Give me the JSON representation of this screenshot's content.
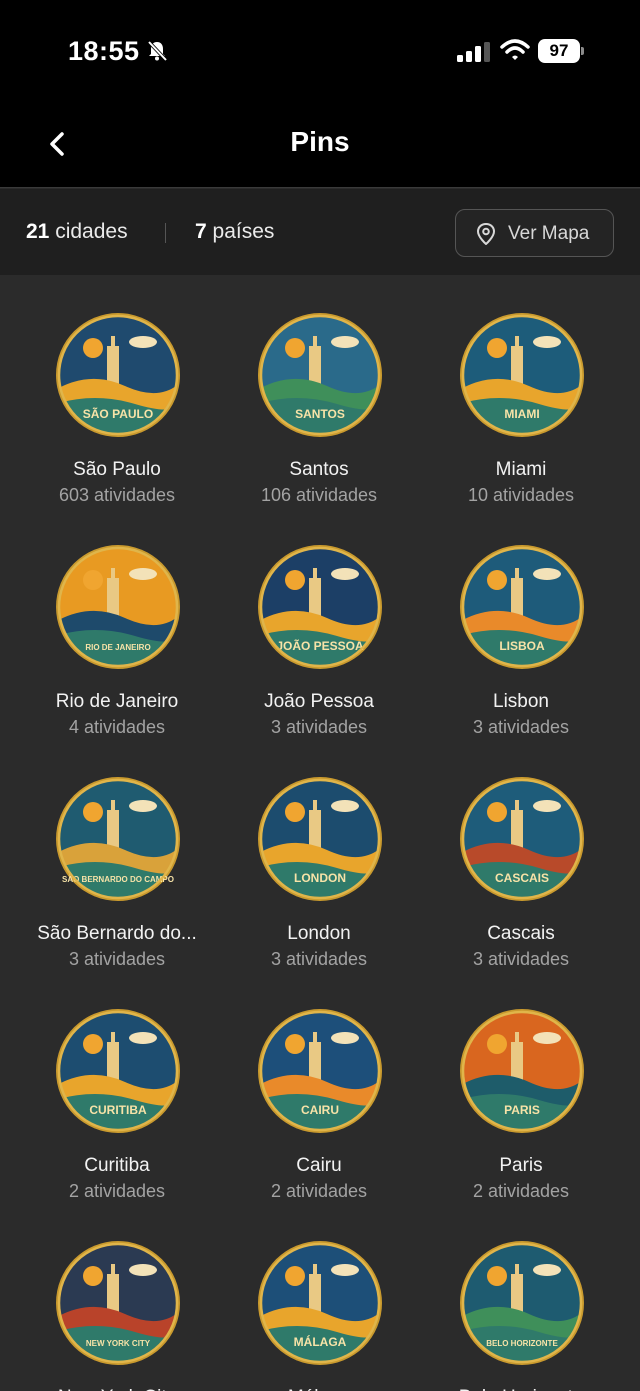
{
  "status_bar": {
    "time": "18:55",
    "battery": "97"
  },
  "nav": {
    "title": "Pins"
  },
  "summary": {
    "cities_count": "21",
    "cities_label": "cidades",
    "countries_count": "7",
    "countries_label": "países",
    "map_button": "Ver Mapa"
  },
  "pins": [
    {
      "city": "São Paulo",
      "activities": "603 atividades",
      "badge_text": "SÃO PAULO",
      "bg": "#1f4a6e",
      "accent": "#e8a52c"
    },
    {
      "city": "Santos",
      "activities": "106 atividades",
      "badge_text": "SANTOS",
      "bg": "#2a6a8a",
      "accent": "#3f8f5a"
    },
    {
      "city": "Miami",
      "activities": "10 atividades",
      "badge_text": "MIAMI",
      "bg": "#1d5c7a",
      "accent": "#e8a52c"
    },
    {
      "city": "Rio de Janeiro",
      "activities": "4 atividades",
      "badge_text": "RIO DE JANEIRO",
      "bg": "#e89a22",
      "accent": "#1e4a6b"
    },
    {
      "city": "João Pessoa",
      "activities": "3 atividades",
      "badge_text": "JOÃO PESSOA",
      "bg": "#1c3f66",
      "accent": "#e8a52c"
    },
    {
      "city": "Lisbon",
      "activities": "3 atividades",
      "badge_text": "LISBOA",
      "bg": "#1e5b7a",
      "accent": "#e98a2a"
    },
    {
      "city": "São Bernardo do...",
      "activities": "3 atividades",
      "badge_text": "SÃO BERNARDO DO CAMPO",
      "bg": "#1f5b70",
      "accent": "#d9a23a"
    },
    {
      "city": "London",
      "activities": "3 atividades",
      "badge_text": "LONDON",
      "bg": "#1c4c6e",
      "accent": "#e8a52c"
    },
    {
      "city": "Cascais",
      "activities": "3 atividades",
      "badge_text": "CASCAIS",
      "bg": "#1e5c7a",
      "accent": "#b84a2a"
    },
    {
      "city": "Curitiba",
      "activities": "2 atividades",
      "badge_text": "CURITIBA",
      "bg": "#1d4d70",
      "accent": "#e8a52c"
    },
    {
      "city": "Cairu",
      "activities": "2 atividades",
      "badge_text": "CAIRU",
      "bg": "#1d4f7a",
      "accent": "#e98a2a"
    },
    {
      "city": "Paris",
      "activities": "2 atividades",
      "badge_text": "PARIS",
      "bg": "#d9661f",
      "accent": "#1e5c6a"
    },
    {
      "city": "New York City",
      "activities": "",
      "badge_text": "NEW YORK CITY",
      "bg": "#2b3a52",
      "accent": "#b9432a"
    },
    {
      "city": "Málaga",
      "activities": "",
      "badge_text": "MÁLAGA",
      "bg": "#1d4f78",
      "accent": "#e8a52c"
    },
    {
      "city": "Belo Horizonte",
      "activities": "",
      "badge_text": "BELO HORIZONTE",
      "bg": "#1e5b70",
      "accent": "#3f8f5a"
    }
  ]
}
